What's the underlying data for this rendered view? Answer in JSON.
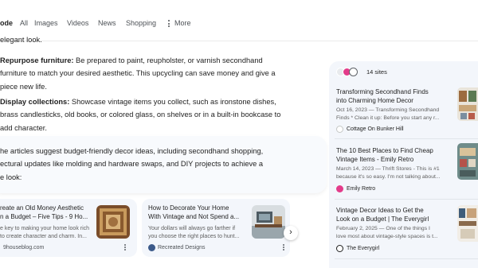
{
  "tabs": {
    "active": "ode",
    "all": "All",
    "images": "Images",
    "videos": "Videos",
    "news": "News",
    "shopping": "Shopping",
    "more": "More"
  },
  "overview": {
    "line_top": "elegant look.",
    "repurpose": {
      "label": "Repurpose furniture:",
      "line1": " Be prepared to paint, reupholster, or varnish secondhand",
      "line2": "furniture to match your desired aesthetic. This upcycling can save money and give a",
      "line3": "piece new life."
    },
    "display": {
      "label": "Display collections:",
      "line1": " Showcase vintage items you collect, such as ironstone dishes,",
      "line2": "brass candlesticks, old books, or colored glass, on shelves or in a built-in bookcase to",
      "line3": "add character."
    },
    "summary": {
      "line1": "he articles suggest budget-friendly decor ideas, including secondhand shopping,",
      "line2": "ectural updates like molding and hardware swaps, and DIY projects to achieve a",
      "line3": "e look:"
    }
  },
  "cards": [
    {
      "title1": "reate an Old Money Aesthetic",
      "title2": "n a Budget – Five Tips - 9 Ho...",
      "snippet1": "e key to making your home look rich",
      "snippet2": "to create character and charm. In...",
      "source": "9houseblog.com"
    },
    {
      "title1": "How to Decorate Your Home",
      "title2": "With Vintage and Not Spend a...",
      "snippet1": "Your dollars will always go farther if",
      "snippet2": "you choose the right places to hunt...",
      "source": "Recreated Designs"
    }
  ],
  "sources": {
    "count_label": "14 sites",
    "items": [
      {
        "title1": "Transforming Secondhand Finds",
        "title2": "into Charming Home Decor",
        "snippet1": "Oct 16, 2023 — Transforming Secondhand",
        "snippet2": "Finds * Clean it up: Before you start any r...",
        "name": "Cottage On Bunker Hill"
      },
      {
        "title1": "The 10 Best Places to Find Cheap",
        "title2": "Vintage Items - Emily Retro",
        "snippet1": "March 14, 2023 — Thrift Stores - This is #1",
        "snippet2": "because it's so easy. I'm not talking about...",
        "name": "Emily Retro"
      },
      {
        "title1": "Vintage Decor Ideas to Get the",
        "title2": "Look on a Budget | The Everygirl",
        "snippet1": "February 2, 2025 — One of the things I",
        "snippet2": "love most about vintage-style spaces is t...",
        "name": "The Everygirl"
      }
    ]
  },
  "colors": {
    "panel_bg": "#f3f6fb",
    "card_bg": "#f3f6fb",
    "summary_bg": "#f8fafd",
    "emily_retro_icon": "#e33b8a"
  },
  "icons": {
    "more": "three-dots-vertical-icon",
    "next": "chevron-right-icon",
    "card_menu": "kebab-menu-icon"
  }
}
